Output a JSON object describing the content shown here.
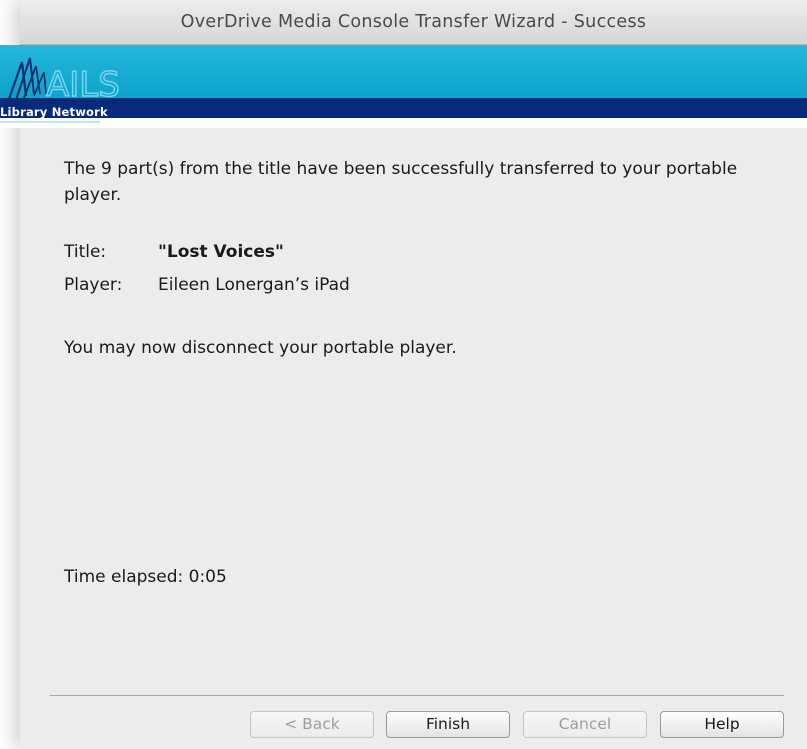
{
  "window": {
    "title": "OverDrive Media Console Transfer Wizard - Success"
  },
  "banner": {
    "logo_text": "Library Network"
  },
  "message": {
    "transfer_text": "The  9 part(s) from the title have been successfully transferred to your portable player.",
    "title_label": "Title:",
    "title_value": "\"Lost Voices\"",
    "player_label": "Player:",
    "player_value": "Eileen Lonergan’s iPad",
    "disconnect_text": "You may now disconnect your portable player.",
    "time_elapsed": "Time elapsed: 0:05"
  },
  "buttons": {
    "back": "< Back",
    "finish": "Finish",
    "cancel": "Cancel",
    "help": "Help"
  },
  "colors": {
    "banner_cyan": "#1aaed6",
    "banner_navy": "#082a7a",
    "window_bg": "#ececec"
  }
}
